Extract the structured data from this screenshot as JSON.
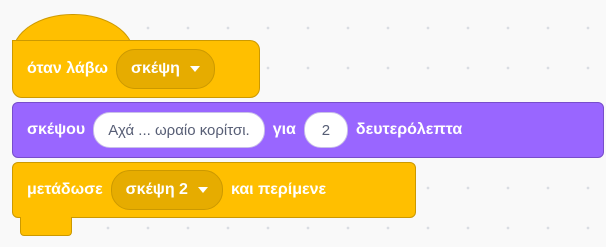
{
  "workspace": {
    "background": "#f9f9f9"
  },
  "blocks": {
    "when_receive": {
      "label": "όταν λάβω",
      "message": "σκέψη",
      "color": "#ffbf00"
    },
    "think_for": {
      "label": "σκέψου",
      "text": "Αχά ... ωραίο κορίτσι.",
      "for_label": "για",
      "seconds": "2",
      "seconds_label": "δευτερόλεπτα",
      "color": "#9966ff"
    },
    "broadcast_wait": {
      "label": "μετάδωσε",
      "message": "σκέψη 2",
      "suffix": "και περίμενε",
      "color": "#ffbf00"
    }
  }
}
